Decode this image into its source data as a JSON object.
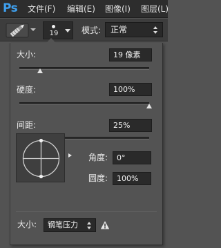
{
  "menubar": {
    "logo": "Ps",
    "items": [
      "文件(F)",
      "编辑(E)",
      "图像(I)",
      "图层(L)"
    ]
  },
  "options_bar": {
    "tool_icon": "brush-tool-icon",
    "brush_size": "19",
    "mode_label": "模式:",
    "mode_value": "正常"
  },
  "brush_panel": {
    "size": {
      "label": "大小:",
      "value": "19 像素",
      "slider_fraction": 0.16
    },
    "hardness": {
      "label": "硬度:",
      "value": "100%",
      "slider_fraction": 1.0
    },
    "spacing": {
      "label": "间距:",
      "value": "25%",
      "slider_fraction": 0.13
    },
    "angle": {
      "label": "角度:",
      "value": "0°"
    },
    "roundness": {
      "label": "圆度:",
      "value": "100%"
    },
    "pen_control": {
      "label": "大小:",
      "value": "钢笔压力",
      "warning_icon": "warning-triangle-icon"
    }
  },
  "colors": {
    "logo": "#3fa0ee",
    "menubar_bg": "#2d2d2d",
    "panel_bg": "#535353",
    "field_bg": "#2a2a2a"
  }
}
